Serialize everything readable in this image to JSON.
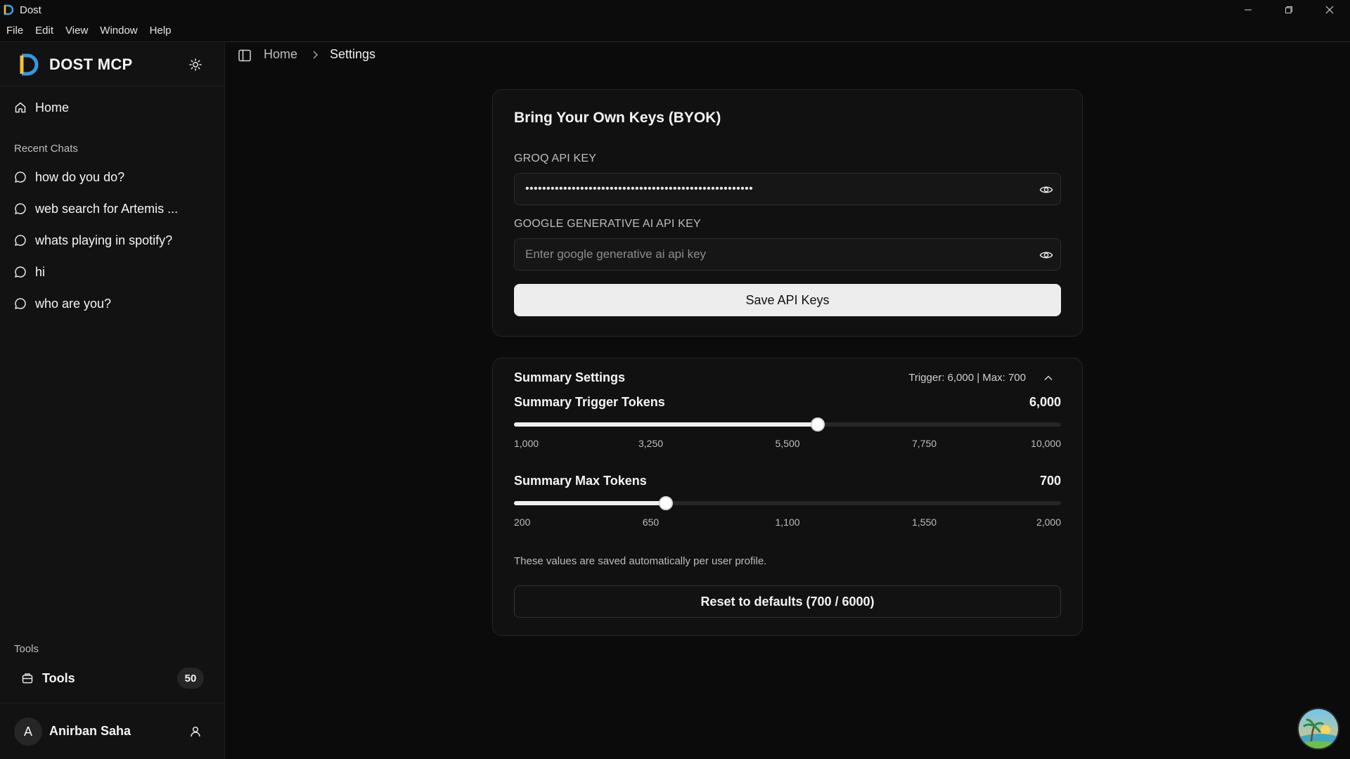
{
  "window": {
    "title": "Dost"
  },
  "menu": [
    "File",
    "Edit",
    "View",
    "Window",
    "Help"
  ],
  "sidebar": {
    "brand": "DOST MCP",
    "home_label": "Home",
    "recent_label": "Recent Chats",
    "recent_chats": [
      "how do you do?",
      "web search for Artemis ...",
      "whats playing in spotify?",
      "hi",
      "who are you?"
    ],
    "tools_section_label": "Tools",
    "tools_label": "Tools",
    "tools_count": "50",
    "user": {
      "initial": "A",
      "name": "Anirban Saha"
    }
  },
  "breadcrumb": {
    "home": "Home",
    "current": "Settings"
  },
  "byok": {
    "title": "Bring Your Own Keys (BYOK)",
    "groq_label": "GROQ API KEY",
    "groq_value": "••••••••••••••••••••••••••••••••••••••••••••••••••••••",
    "google_label": "GOOGLE GENERATIVE AI API KEY",
    "google_placeholder": "Enter google generative ai api key",
    "save_label": "Save API Keys"
  },
  "summary": {
    "title": "Summary Settings",
    "meta": "Trigger: 6,000 | Max: 700",
    "trigger": {
      "label": "Summary Trigger Tokens",
      "value_text": "6,000",
      "value": 6000,
      "min": 1000,
      "max": 10000,
      "ticks": [
        "1,000",
        "3,250",
        "5,500",
        "7,750",
        "10,000"
      ]
    },
    "max_tokens": {
      "label": "Summary Max Tokens",
      "value_text": "700",
      "value": 700,
      "min": 200,
      "max": 2000,
      "ticks": [
        "200",
        "650",
        "1,100",
        "1,550",
        "2,000"
      ]
    },
    "hint": "These values are saved automatically per user profile.",
    "reset_label": "Reset to defaults (700 / 6000)"
  },
  "colors": {
    "background": "#0b0b0b",
    "sidebar": "#121212",
    "card": "#111111",
    "primary_button": "#ededed"
  }
}
